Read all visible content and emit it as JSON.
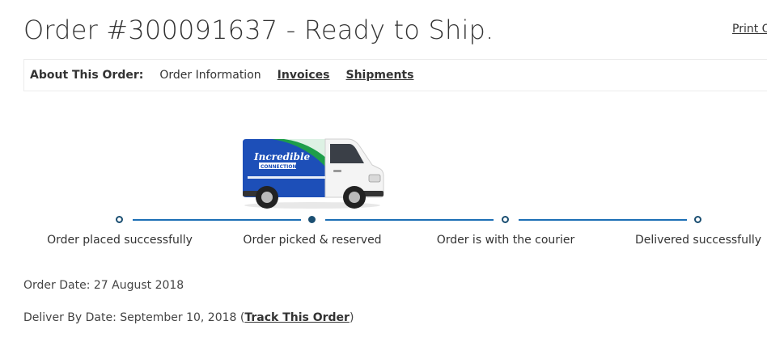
{
  "header": {
    "title": "Order #300091637 - Ready to Ship.",
    "print_label": "Print O"
  },
  "nav": {
    "label": "About This Order:",
    "items": [
      {
        "label": "Order Information",
        "active": true
      },
      {
        "label": "Invoices",
        "active": false
      },
      {
        "label": "Shipments",
        "active": false
      }
    ]
  },
  "tracker": {
    "van_brand_line1": "Incredible",
    "van_brand_line2": "CONNECTION",
    "current_step": 1,
    "steps": [
      {
        "label": "Order placed successfully"
      },
      {
        "label": "Order picked & reserved"
      },
      {
        "label": "Order is with the courier"
      },
      {
        "label": "Delivered successfully"
      }
    ]
  },
  "details": {
    "order_date": "Order Date: 27 August 2018",
    "deliver_by_prefix": "Deliver By Date: September 10, 2018 (",
    "track_link": "Track This Order",
    "deliver_by_suffix": ")"
  },
  "colors": {
    "accent": "#1c6fb5",
    "dot": "#1b4f72",
    "van_blue": "#1d4fb8",
    "van_green": "#1e9e4a"
  }
}
